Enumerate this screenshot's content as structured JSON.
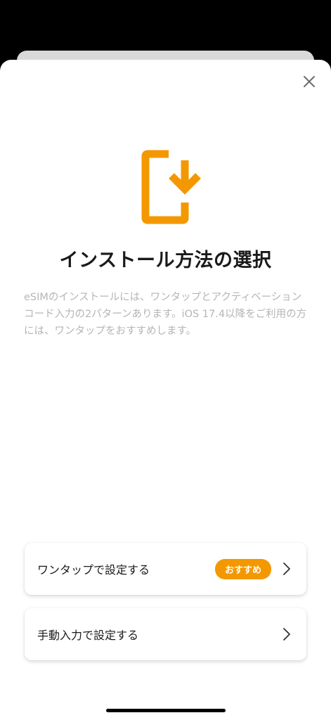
{
  "modal": {
    "title": "インストール方法の選択",
    "description": "eSIMのインストールには、ワンタップとアクティベーションコード入力の2パターンあります。iOS 17.4以降をご利用の方には、ワンタップをおすすめします。",
    "close_icon": "close-icon",
    "hero_icon": "phone-download-icon"
  },
  "options": [
    {
      "label": "ワンタップで設定する",
      "badge": "おすすめ",
      "icon": "chevron-right-icon"
    },
    {
      "label": "手動入力で設定する",
      "icon": "chevron-right-icon"
    }
  ],
  "colors": {
    "accent": "#f39800",
    "title": "#1a1a1a",
    "description": "#b5b5b5"
  }
}
